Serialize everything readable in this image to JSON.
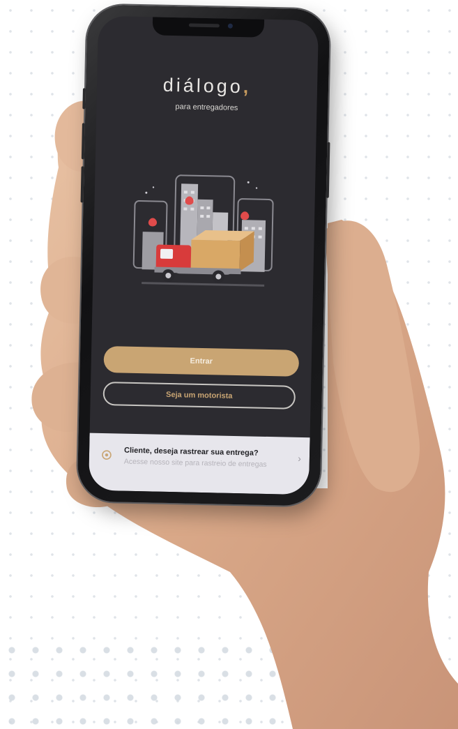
{
  "app": {
    "logo_text": "diálogo",
    "logo_punct": ",",
    "tagline": "para entregadores"
  },
  "actions": {
    "primary_label": "Entrar",
    "secondary_label": "Seja um motorista"
  },
  "tracking_card": {
    "title": "Cliente, deseja rastrear sua entrega?",
    "subtitle": "Acesse nosso site para rastreio de entregas",
    "chevron_icon": "chevron-right-icon",
    "leading_icon": "location-pin-icon"
  },
  "colors": {
    "accent": "#c9a573",
    "screen_bg": "#2c2b30",
    "card_bg": "#e7e6ec"
  }
}
